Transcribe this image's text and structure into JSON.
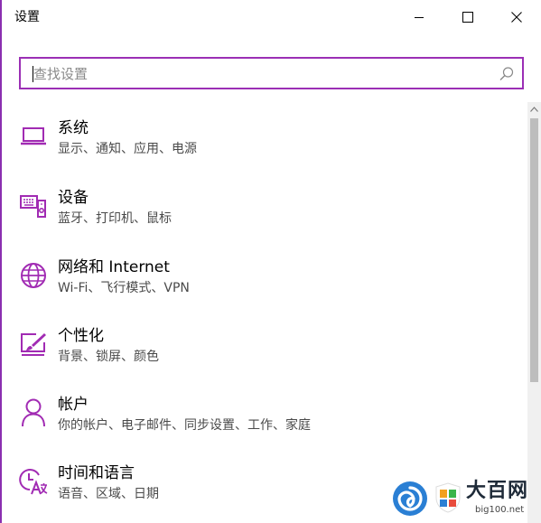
{
  "window": {
    "title": "设置",
    "border_color": "#8a2fb0"
  },
  "search": {
    "placeholder": "查找设置",
    "value": "",
    "accent_color": "#9b2fb5"
  },
  "icon_color": "#a12bb3",
  "settings": [
    {
      "label": "系统",
      "desc": "显示、通知、应用、电源",
      "icon": "laptop-icon"
    },
    {
      "label": "设备",
      "desc": "蓝牙、打印机、鼠标",
      "icon": "devices-icon"
    },
    {
      "label": "网络和 Internet",
      "desc": "Wi-Fi、飞行模式、VPN",
      "icon": "globe-icon"
    },
    {
      "label": "个性化",
      "desc": "背景、锁屏、颜色",
      "icon": "paint-icon"
    },
    {
      "label": "帐户",
      "desc": "你的帐户、电子邮件、同步设置、工作、家庭",
      "icon": "person-icon"
    },
    {
      "label": "时间和语言",
      "desc": "语音、区域、日期",
      "icon": "time-language-icon"
    }
  ],
  "watermark": {
    "brand": "大百网",
    "url": "big100.net"
  }
}
